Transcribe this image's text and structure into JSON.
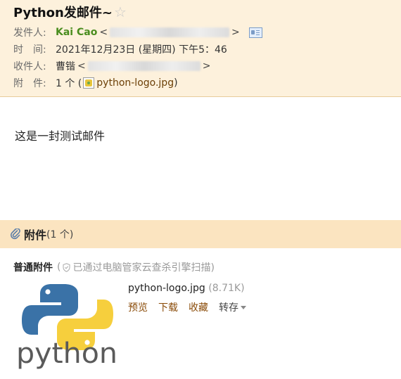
{
  "email": {
    "subject": "Python发邮件~",
    "sender_label": "发件人:",
    "sender_name": "Kai Cao",
    "time_label": "时　间:",
    "time_value": "2021年12月23日 (星期四) 下午5：46",
    "recipient_label": "收件人:",
    "recipient_name": "曹锴",
    "attachment_label": "附　件:",
    "attachment_count": "1 个 (",
    "attachment_file": "python-logo.jpg",
    "attachment_close": ")",
    "body_text": "这是一封测试邮件"
  },
  "attachments": {
    "title": "附件",
    "count": "(1 个)",
    "section_title": "普通附件",
    "scan_prefix": "(",
    "scan_text": "已通过电脑管家云查杀引擎扫描)",
    "file_name": "python-logo.jpg",
    "file_size": "(8.71K)",
    "thumb_text": "python",
    "actions": {
      "preview": "预览",
      "download": "下载",
      "favorite": "收藏",
      "forward": "转存"
    }
  },
  "colors": {
    "header_bg": "#fdf1dc",
    "attach_bar_bg": "#fbe4c0",
    "sender_green": "#4a8d1e",
    "link_brown": "#8a4b08",
    "python_blue": "#3a72a7",
    "python_yellow": "#f6cf3d"
  },
  "icons": [
    "star-icon",
    "contact-card-icon",
    "image-file-icon",
    "paperclip-icon",
    "shield-icon",
    "dropdown-caret-icon"
  ]
}
